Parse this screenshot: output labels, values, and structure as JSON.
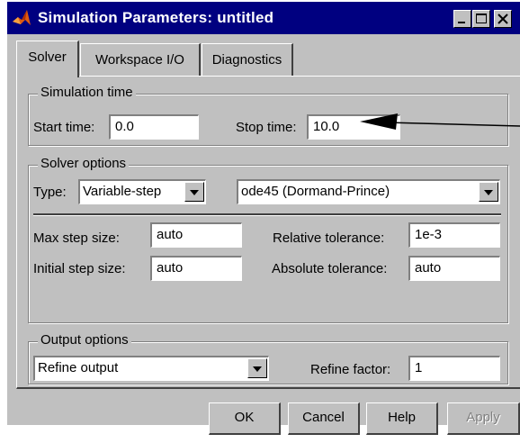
{
  "window": {
    "title": "Simulation Parameters: untitled",
    "title_bar_color": "#000080",
    "face_color": "#c0c0c0"
  },
  "title_bar_buttons": [
    "minimize-icon",
    "maximize-icon",
    "close-icon"
  ],
  "tabs": [
    {
      "label": "Solver",
      "active": true
    },
    {
      "label": "Workspace I/O",
      "active": false
    },
    {
      "label": "Diagnostics",
      "active": false
    }
  ],
  "simulation_time": {
    "legend": "Simulation time",
    "start_label": "Start time:",
    "start_value": "0.0",
    "stop_label": "Stop time:",
    "stop_value": "10.0"
  },
  "solver_options": {
    "legend": "Solver options",
    "type_label": "Type:",
    "type_value": "Variable-step",
    "solver_value": "ode45 (Dormand-Prince)",
    "max_step_label": "Max step size:",
    "max_step_value": "auto",
    "initial_step_label": "Initial step size:",
    "initial_step_value": "auto",
    "rel_tol_label": "Relative tolerance:",
    "rel_tol_value": "1e-3",
    "abs_tol_label": "Absolute tolerance:",
    "abs_tol_value": "auto"
  },
  "output_options": {
    "legend": "Output options",
    "output_value": "Refine output",
    "refine_label": "Refine factor:",
    "refine_value": "1"
  },
  "buttons": {
    "ok": "OK",
    "cancel": "Cancel",
    "help": "Help",
    "apply": "Apply"
  }
}
